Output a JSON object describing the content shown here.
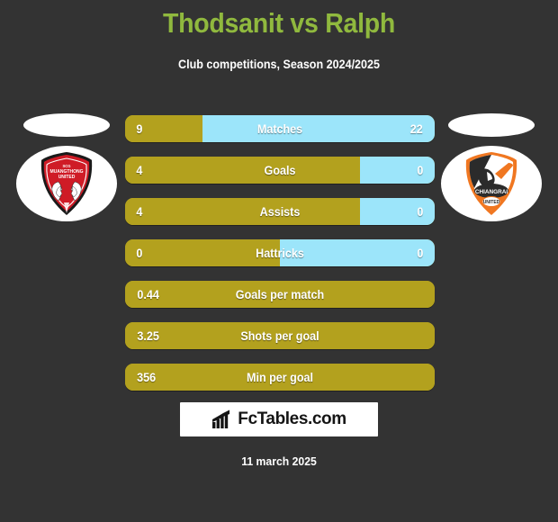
{
  "header": {
    "title": "Thodsanit vs Ralph",
    "subtitle": "Club competitions, Season 2024/2025",
    "title_color": "#90b93e",
    "subtitle_color": "#ffffff"
  },
  "teams": {
    "home": {
      "name": "SCG Muangthong United",
      "crest_name": "muangthong-united-crest",
      "primary_color": "#cf1b26",
      "accent_color": "#1a1a1a"
    },
    "away": {
      "name": "Chiangrai United",
      "crest_name": "chiangrai-united-crest",
      "primary_color": "#f07721",
      "accent_color": "#2b2b2b"
    }
  },
  "colors": {
    "background": "#333333",
    "home_bar": "#b3a11e",
    "away_bar": "#9ce5fa",
    "text": "#ffffff"
  },
  "chart_data": {
    "type": "bar",
    "title": "Thodsanit vs Ralph",
    "subtitle": "Club competitions, Season 2024/2025",
    "orientation": "horizontal-diverging",
    "categories": [
      "Matches",
      "Goals",
      "Assists",
      "Hattricks",
      "Goals per match",
      "Shots per goal",
      "Min per goal"
    ],
    "series": [
      {
        "name": "Thodsanit",
        "color": "#b3a11e",
        "values": [
          "9",
          "4",
          "4",
          "0",
          "0.44",
          "3.25",
          "356"
        ]
      },
      {
        "name": "Ralph",
        "color": "#9ce5fa",
        "values": [
          "22",
          "0",
          "0",
          "0",
          null,
          null,
          null
        ]
      }
    ],
    "legend": "none",
    "grid": false
  },
  "stats": [
    {
      "label": "Matches",
      "home": "9",
      "away": "22",
      "home_pct": 25,
      "two_sided": true
    },
    {
      "label": "Goals",
      "home": "4",
      "away": "0",
      "home_pct": 76,
      "two_sided": true
    },
    {
      "label": "Assists",
      "home": "4",
      "away": "0",
      "home_pct": 76,
      "two_sided": true
    },
    {
      "label": "Hattricks",
      "home": "0",
      "away": "0",
      "home_pct": 50,
      "two_sided": true
    },
    {
      "label": "Goals per match",
      "home": "0.44",
      "away": "",
      "home_pct": 100,
      "two_sided": false
    },
    {
      "label": "Shots per goal",
      "home": "3.25",
      "away": "",
      "home_pct": 100,
      "two_sided": false
    },
    {
      "label": "Min per goal",
      "home": "356",
      "away": "",
      "home_pct": 100,
      "two_sided": false
    }
  ],
  "footer": {
    "brand": "FcTables.com",
    "brand_icon": "bar-chart-icon",
    "date": "11 march 2025"
  }
}
